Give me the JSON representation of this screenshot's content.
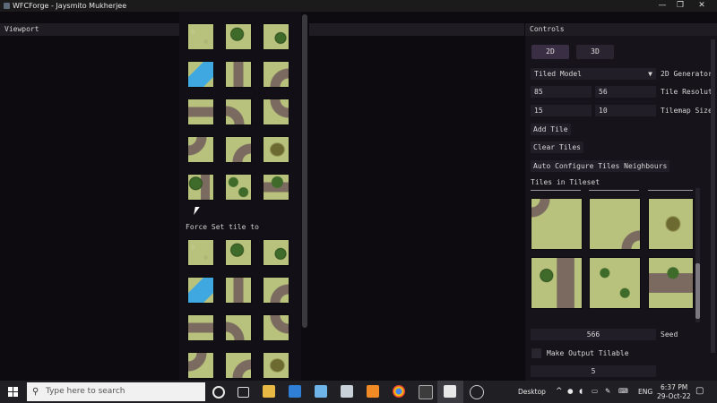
{
  "window": {
    "title": "WFCForge - Jaysmito Mukherjee",
    "minimize_glyph": "—",
    "maximize_glyph": "❐",
    "close_glyph": "✕"
  },
  "viewport": {
    "header": "Viewport"
  },
  "palette": {
    "force_label": "Force Set tile to"
  },
  "controls": {
    "header": "Controls",
    "tabs": [
      "2D",
      "3D"
    ],
    "model_select": {
      "value": "Tiled Model",
      "label": "2D Generator"
    },
    "tile_res": {
      "a": "85",
      "b": "56",
      "label": "Tile Resolut"
    },
    "tilemap_size": {
      "a": "15",
      "b": "10",
      "label": "Tilemap Size"
    },
    "buttons": {
      "add_tile": "Add Tile",
      "clear_tiles": "Clear Tiles",
      "auto_configure": "Auto Configure Tiles Neighbours"
    },
    "tiles_in_tileset": "Tiles in Tileset",
    "seed": {
      "value": "566",
      "label": "Seed"
    },
    "make_tilable": "Make Output Tilable",
    "last_value": "5"
  },
  "taskbar": {
    "search_placeholder": "Type here to search",
    "desktop_label": "Desktop",
    "lang": "ENG",
    "time": "6:37 PM",
    "date": "29-Oct-22"
  }
}
